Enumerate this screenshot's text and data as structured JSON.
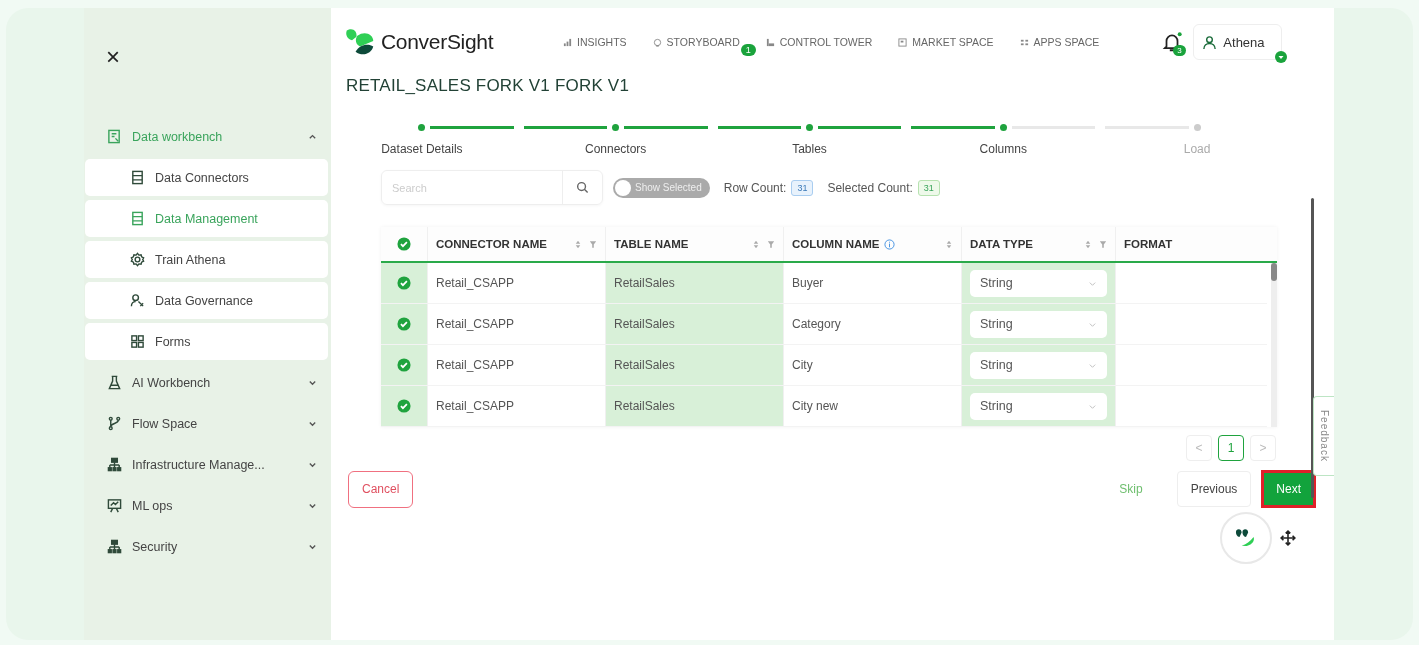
{
  "sidebar": {
    "close": "×",
    "items": [
      {
        "label": "Data workbench",
        "expanded": true,
        "children": [
          {
            "label": "Data Connectors",
            "selected": false
          },
          {
            "label": "Data Management",
            "selected": true
          },
          {
            "label": "Train Athena",
            "selected": false
          },
          {
            "label": "Data Governance",
            "selected": false
          },
          {
            "label": "Forms",
            "selected": false
          }
        ]
      },
      {
        "label": "AI Workbench",
        "expanded": false
      },
      {
        "label": "Flow Space",
        "expanded": false
      },
      {
        "label": "Infrastructure Manage...",
        "expanded": false
      },
      {
        "label": "ML ops",
        "expanded": false
      },
      {
        "label": "Security",
        "expanded": false
      }
    ]
  },
  "header": {
    "logo": "ConverSight",
    "nav": [
      {
        "label": "INSIGHTS"
      },
      {
        "label": "STORYBOARD",
        "badge": "1"
      },
      {
        "label": "CONTROL TOWER"
      },
      {
        "label": "MARKET SPACE"
      },
      {
        "label": "APPS SPACE"
      }
    ],
    "notifications": "3",
    "user": "Athena"
  },
  "title": "RETAIL_SALES FORK V1 FORK V1",
  "steps": [
    {
      "label": "Dataset Details",
      "completed": true
    },
    {
      "label": "Connectors",
      "completed": true
    },
    {
      "label": "Tables",
      "completed": true
    },
    {
      "label": "Columns",
      "completed": true
    },
    {
      "label": "Load",
      "completed": false
    }
  ],
  "toolbar": {
    "search_placeholder": "Search",
    "toggle": {
      "label": "Show Selected",
      "on": false
    },
    "row_count_label": "Row Count:",
    "row_count": "31",
    "selected_count_label": "Selected Count:",
    "selected_count": "31"
  },
  "table": {
    "all_checked": true,
    "columns": [
      {
        "label": "CONNECTOR NAME"
      },
      {
        "label": "TABLE NAME"
      },
      {
        "label": "COLUMN NAME"
      },
      {
        "label": "DATA TYPE"
      },
      {
        "label": "FORMAT"
      }
    ],
    "rows": [
      {
        "checked": true,
        "connector": "Retail_CSAPP",
        "table": "RetailSales",
        "column": "Buyer",
        "data_type": "String"
      },
      {
        "checked": true,
        "connector": "Retail_CSAPP",
        "table": "RetailSales",
        "column": "Category",
        "data_type": "String"
      },
      {
        "checked": true,
        "connector": "Retail_CSAPP",
        "table": "RetailSales",
        "column": "City",
        "data_type": "String"
      },
      {
        "checked": true,
        "connector": "Retail_CSAPP",
        "table": "RetailSales",
        "column": "City new",
        "data_type": "String"
      }
    ]
  },
  "pagination": {
    "prev": "<",
    "next": ">",
    "pages": [
      {
        "label": "1",
        "selected": true
      }
    ]
  },
  "buttons": {
    "cancel": "Cancel",
    "skip": "Skip",
    "previous": "Previous",
    "next": "Next"
  },
  "feedback": "Feedback"
}
